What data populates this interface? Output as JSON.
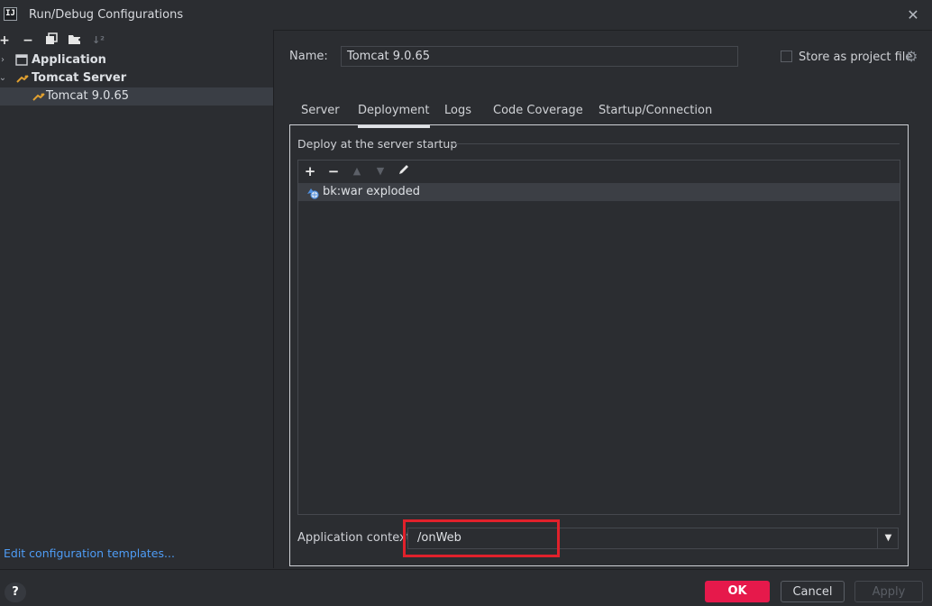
{
  "window": {
    "title": "Run/Debug Configurations",
    "logo_text": "IJ"
  },
  "toolbar": {
    "icons": [
      "add-icon",
      "remove-icon",
      "copy-icon",
      "new-folder-icon",
      "sort-icon"
    ]
  },
  "tree": {
    "items": [
      {
        "label": "Application",
        "level": 0,
        "expanded": false,
        "icon": "application-icon",
        "bold": true
      },
      {
        "label": "Tomcat Server",
        "level": 0,
        "expanded": true,
        "icon": "tomcat-icon",
        "bold": true
      },
      {
        "label": "Tomcat 9.0.65",
        "level": 1,
        "selected": true,
        "icon": "tomcat-icon",
        "bold": false
      }
    ]
  },
  "left_footer": {
    "link": "Edit configuration templates..."
  },
  "name_row": {
    "label": "Name:",
    "value": "Tomcat 9.0.65"
  },
  "store": {
    "label": "Store as project file",
    "checked": false
  },
  "tabs": [
    {
      "label": "Server",
      "active": false
    },
    {
      "label": "Deployment",
      "active": true
    },
    {
      "label": "Logs",
      "active": false
    },
    {
      "label": "Code Coverage",
      "active": false
    },
    {
      "label": "Startup/Connection",
      "active": false
    }
  ],
  "deployment": {
    "section_title": "Deploy at the server startup",
    "artifacts": [
      {
        "label": "bk:war exploded"
      }
    ],
    "context_label": "Application context:",
    "context_value": "/onWeb"
  },
  "buttons": {
    "help": "?",
    "ok": "OK",
    "cancel": "Cancel",
    "apply": "Apply"
  },
  "colors": {
    "accent": "#e6194b",
    "link": "#4e9cf5",
    "highlight": "#e0212b",
    "background": "#2b2d31"
  }
}
